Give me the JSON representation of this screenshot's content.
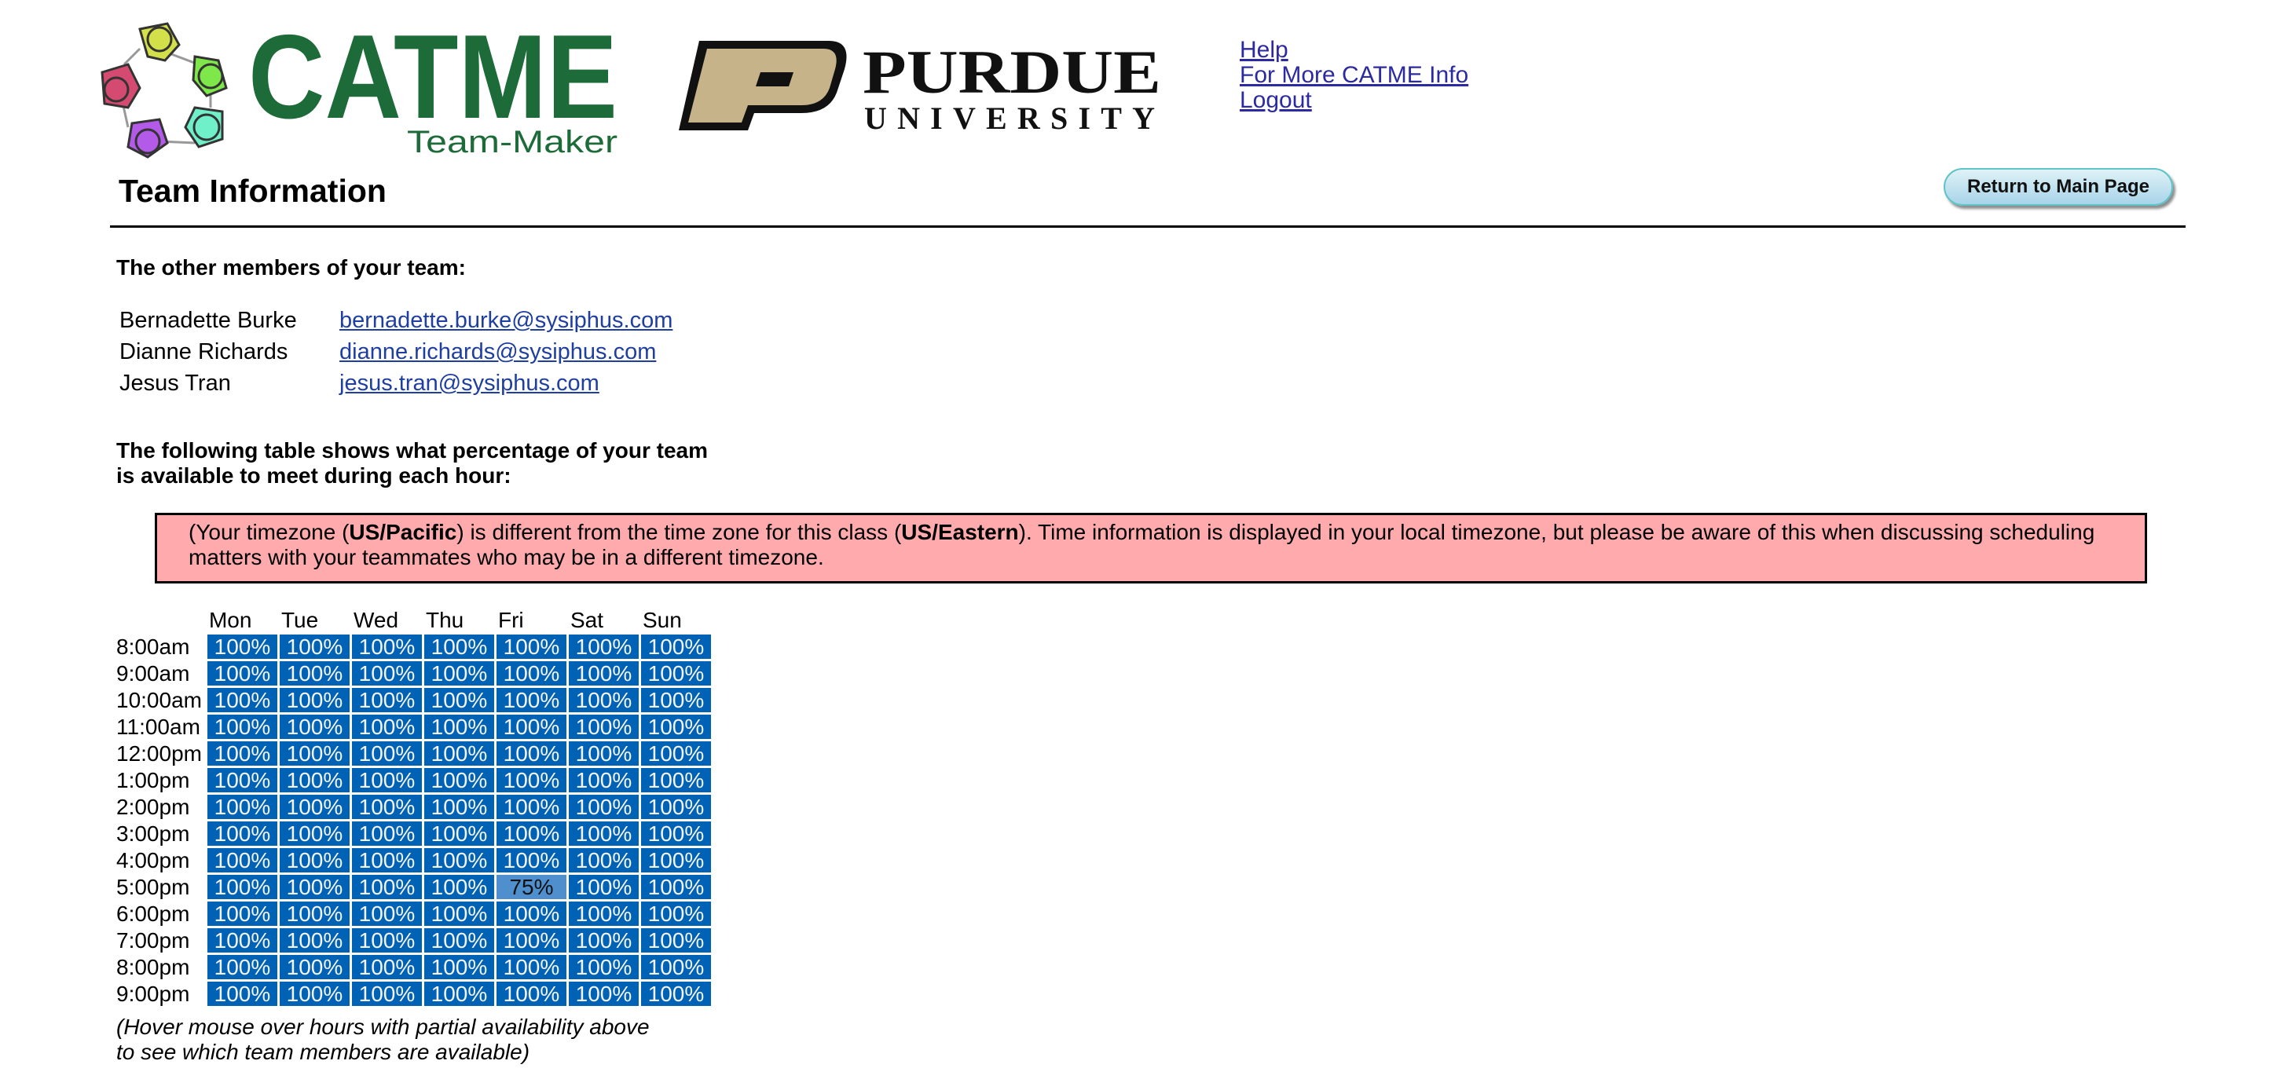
{
  "header": {
    "catme_logo_text": "CATME",
    "catme_logo_subtitle": "Team-Maker",
    "purdue_logo_line1": "PURDUE",
    "purdue_logo_line2": "UNIVERSITY",
    "links": [
      "Help",
      "For More CATME Info",
      "Logout"
    ]
  },
  "page": {
    "title": "Team Information",
    "return_button": "Return to Main Page"
  },
  "members_section": {
    "heading": "The other members of your team:",
    "members": [
      {
        "name": "Bernadette Burke",
        "email": "bernadette.burke@sysiphus.com"
      },
      {
        "name": "Dianne Richards",
        "email": "dianne.richards@sysiphus.com"
      },
      {
        "name": "Jesus Tran",
        "email": "jesus.tran@sysiphus.com"
      }
    ]
  },
  "availability_section": {
    "heading_line1": "The following table shows what percentage of your team",
    "heading_line2": "is available to meet during each hour:",
    "notice": {
      "part1": "(Your timezone (",
      "user_tz": "US/Pacific",
      "part2": ") is different from the time zone for this class (",
      "class_tz": "US/Eastern",
      "part3": "). Time information is displayed in your local timezone, but please be aware of this when discussing scheduling matters with your teammates who may be in a different timezone."
    },
    "days": [
      "Mon",
      "Tue",
      "Wed",
      "Thu",
      "Fri",
      "Sat",
      "Sun"
    ],
    "hours": [
      "8:00am",
      "9:00am",
      "10:00am",
      "11:00am",
      "12:00pm",
      "1:00pm",
      "2:00pm",
      "3:00pm",
      "4:00pm",
      "5:00pm",
      "6:00pm",
      "7:00pm",
      "8:00pm",
      "9:00pm"
    ],
    "values": [
      [
        100,
        100,
        100,
        100,
        100,
        100,
        100
      ],
      [
        100,
        100,
        100,
        100,
        100,
        100,
        100
      ],
      [
        100,
        100,
        100,
        100,
        100,
        100,
        100
      ],
      [
        100,
        100,
        100,
        100,
        100,
        100,
        100
      ],
      [
        100,
        100,
        100,
        100,
        100,
        100,
        100
      ],
      [
        100,
        100,
        100,
        100,
        100,
        100,
        100
      ],
      [
        100,
        100,
        100,
        100,
        100,
        100,
        100
      ],
      [
        100,
        100,
        100,
        100,
        100,
        100,
        100
      ],
      [
        100,
        100,
        100,
        100,
        100,
        100,
        100
      ],
      [
        100,
        100,
        100,
        100,
        75,
        100,
        100
      ],
      [
        100,
        100,
        100,
        100,
        100,
        100,
        100
      ],
      [
        100,
        100,
        100,
        100,
        100,
        100,
        100
      ],
      [
        100,
        100,
        100,
        100,
        100,
        100,
        100
      ],
      [
        100,
        100,
        100,
        100,
        100,
        100,
        100
      ]
    ],
    "footnote_line1": "(Hover mouse over hours with partial availability above",
    "footnote_line2": "to see which team members are available)"
  },
  "colors": {
    "full_availability": "#0062b4",
    "partial_availability": "#4f8fcd",
    "notice_background": "#ffaaad",
    "link": "#1f3fa0",
    "catme_green": "#1e6b3a",
    "purdue_gold": "#c7b38a"
  }
}
